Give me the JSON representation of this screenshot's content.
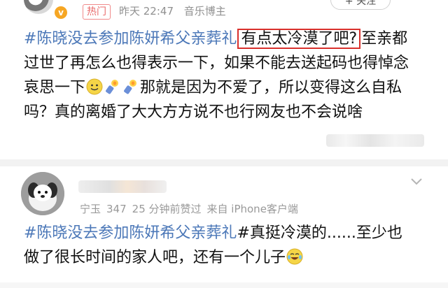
{
  "post": {
    "badge_symbol": "v",
    "hot_tag": "热门",
    "time": "昨天 22:47",
    "source": "音乐博主",
    "follow_label": "+ 关注",
    "text": {
      "hashtag": "#陈晓没去参加陈妍希父亲葬礼",
      "highlighted": "有点太冷漠了吧?",
      "part1": "至亲都过世了再怎么也得表示一下，如果不能去送起码也得悼念哀思一下",
      "part2": "那就是因为不爱了，所以变得这么自私吗？真的离婚了大大方方说不也行网友也不会说啥"
    },
    "emojis": [
      "smile-emoji",
      "candle-emoji",
      "candle-emoji"
    ]
  },
  "comment": {
    "meta_location": "宁玉",
    "meta_votes": "347",
    "meta_time": "25 分钟前赞过",
    "meta_from": "来自 iPhone客户端",
    "text": {
      "hashtag": "#陈晓没去参加陈妍希父亲葬礼",
      "part1": "#真挺冷漠的......至少也做了很长时间的家人吧，还有一个儿子"
    },
    "emoji": "laugh-cry-emoji"
  },
  "colors": {
    "hashtag": "#4c78b8",
    "highlight_border": "#d9302c",
    "meta_text": "#909090",
    "hot_tag": "#e96a6a"
  }
}
